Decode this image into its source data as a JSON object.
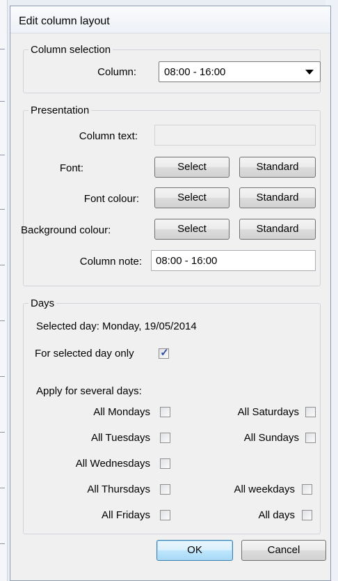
{
  "dialog": {
    "title": "Edit column layout"
  },
  "column_selection": {
    "legend": "Column selection",
    "column_label": "Column:",
    "column_value": "08:00 - 16:00"
  },
  "presentation": {
    "legend": "Presentation",
    "column_text_label": "Column text:",
    "column_text_value": "",
    "font_label": "Font:",
    "font_colour_label": "Font colour:",
    "background_colour_label": "Background colour:",
    "select_label": "Select",
    "standard_label": "Standard",
    "column_note_label": "Column note:",
    "column_note_value": "08:00 - 16:00"
  },
  "days": {
    "legend": "Days",
    "selected_day": "Selected day: Monday, 19/05/2014",
    "for_selected_day_only_label": "For selected day only",
    "for_selected_day_only_checked": true,
    "apply_label": "Apply for several days:",
    "left_options": [
      {
        "label": "All Mondays",
        "checked": false
      },
      {
        "label": "All Tuesdays",
        "checked": false
      },
      {
        "label": "All Wednesdays",
        "checked": false
      },
      {
        "label": "All Thursdays",
        "checked": false
      },
      {
        "label": "All Fridays",
        "checked": false
      }
    ],
    "right_options": [
      {
        "label": "All Saturdays",
        "checked": false
      },
      {
        "label": "All Sundays",
        "checked": false
      },
      {
        "label": "All weekdays",
        "checked": false
      },
      {
        "label": "All days",
        "checked": false
      }
    ]
  },
  "buttons": {
    "ok": "OK",
    "cancel": "Cancel"
  }
}
